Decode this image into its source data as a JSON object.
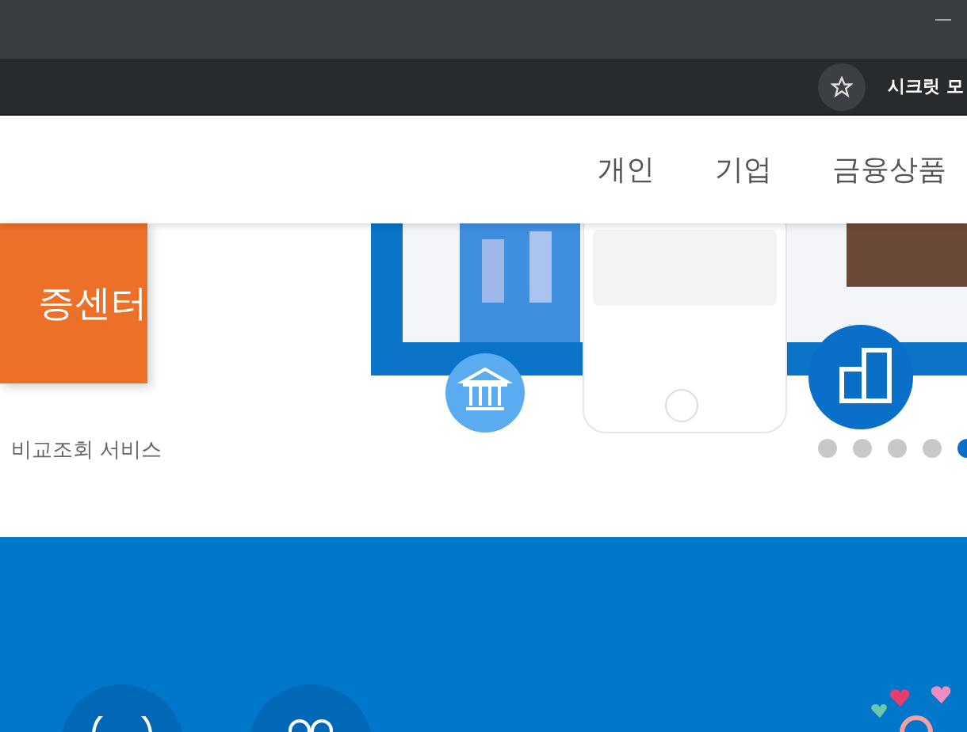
{
  "browser": {
    "profile_label": "시크릿 모"
  },
  "nav": {
    "items": [
      {
        "label": "개인"
      },
      {
        "label": "기업"
      },
      {
        "label": "금융상품"
      }
    ]
  },
  "hero": {
    "card_title": "증센터",
    "caption": "비교조회 서비스",
    "dots": [
      {
        "selected": false
      },
      {
        "selected": false
      },
      {
        "selected": false
      },
      {
        "selected": false
      },
      {
        "selected": true
      }
    ]
  }
}
